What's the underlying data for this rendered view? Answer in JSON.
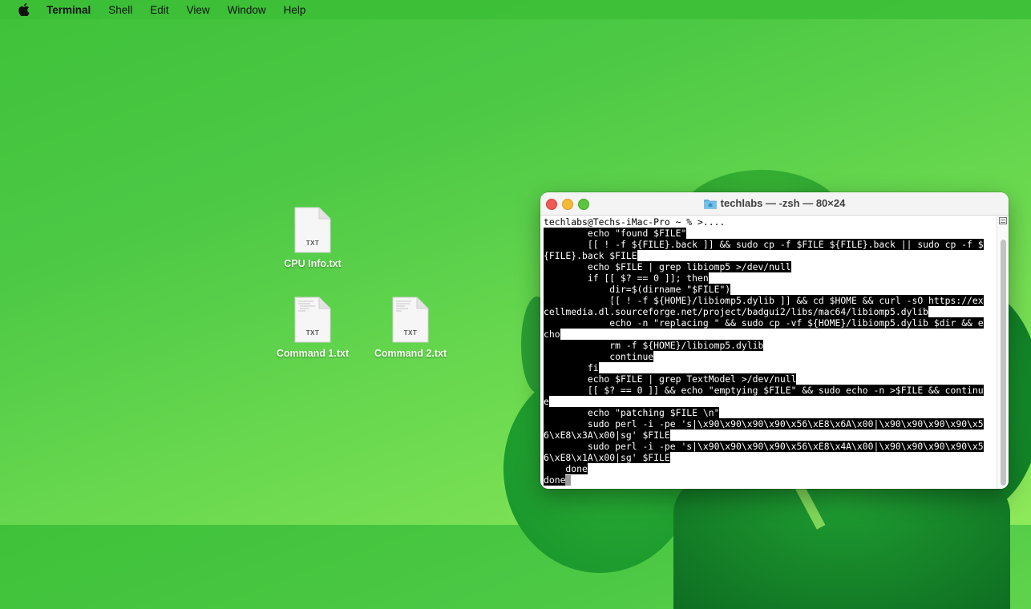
{
  "menubar": {
    "apple_icon": "apple-logo-icon",
    "app_name": "Terminal",
    "items": [
      "Shell",
      "Edit",
      "View",
      "Window",
      "Help"
    ]
  },
  "desktop": {
    "icons": [
      {
        "label": "CPU Info.txt",
        "type": "TXT"
      },
      {
        "label": "Command 1.txt",
        "type": "TXT"
      },
      {
        "label": "Command 2.txt",
        "type": "TXT"
      }
    ]
  },
  "terminal": {
    "title": "techlabs — -zsh — 80×24",
    "title_icon": "home-folder-icon",
    "prompt_line": "techlabs@Techs-iMac-Pro ~ % >....",
    "selected_lines": [
      "        echo \"found $FILE\"",
      "        [[ ! -f ${FILE}.back ]] && sudo cp -f $FILE ${FILE}.back || sudo cp -f $",
      "{FILE}.back $FILE",
      "        echo $FILE | grep libiomp5 >/dev/null",
      "        if [[ $? == 0 ]]; then",
      "            dir=$(dirname \"$FILE\")",
      "            [[ ! -f ${HOME}/libiomp5.dylib ]] && cd $HOME && curl -sO https://ex",
      "cellmedia.dl.sourceforge.net/project/badgui2/libs/mac64/libiomp5.dylib",
      "            echo -n \"replacing \" && sudo cp -vf ${HOME}/libiomp5.dylib $dir && e",
      "cho",
      "            rm -f ${HOME}/libiomp5.dylib",
      "            continue",
      "        fi",
      "        echo $FILE | grep TextModel >/dev/null",
      "        [[ $? == 0 ]] && echo \"emptying $FILE\" && sudo echo -n >$FILE && continu",
      "e",
      "        echo \"patching $FILE \\n\"",
      "        sudo perl -i -pe 's|\\x90\\x90\\x90\\x90\\x56\\xE8\\x6A\\x00|\\x90\\x90\\x90\\x90\\x5",
      "6\\xE8\\x3A\\x00|sg' $FILE",
      "        sudo perl -i -pe 's|\\x90\\x90\\x90\\x90\\x56\\xE8\\x4A\\x00|\\x90\\x90\\x90\\x90\\x5",
      "6\\xE8\\x1A\\x00|sg' $FILE",
      "    done",
      "done"
    ]
  },
  "colors": {
    "selection_bg": "#000000",
    "selection_fg": "#ffffff",
    "close": "#ee5a56",
    "minimize": "#f5b938",
    "zoom": "#5bc53e"
  }
}
